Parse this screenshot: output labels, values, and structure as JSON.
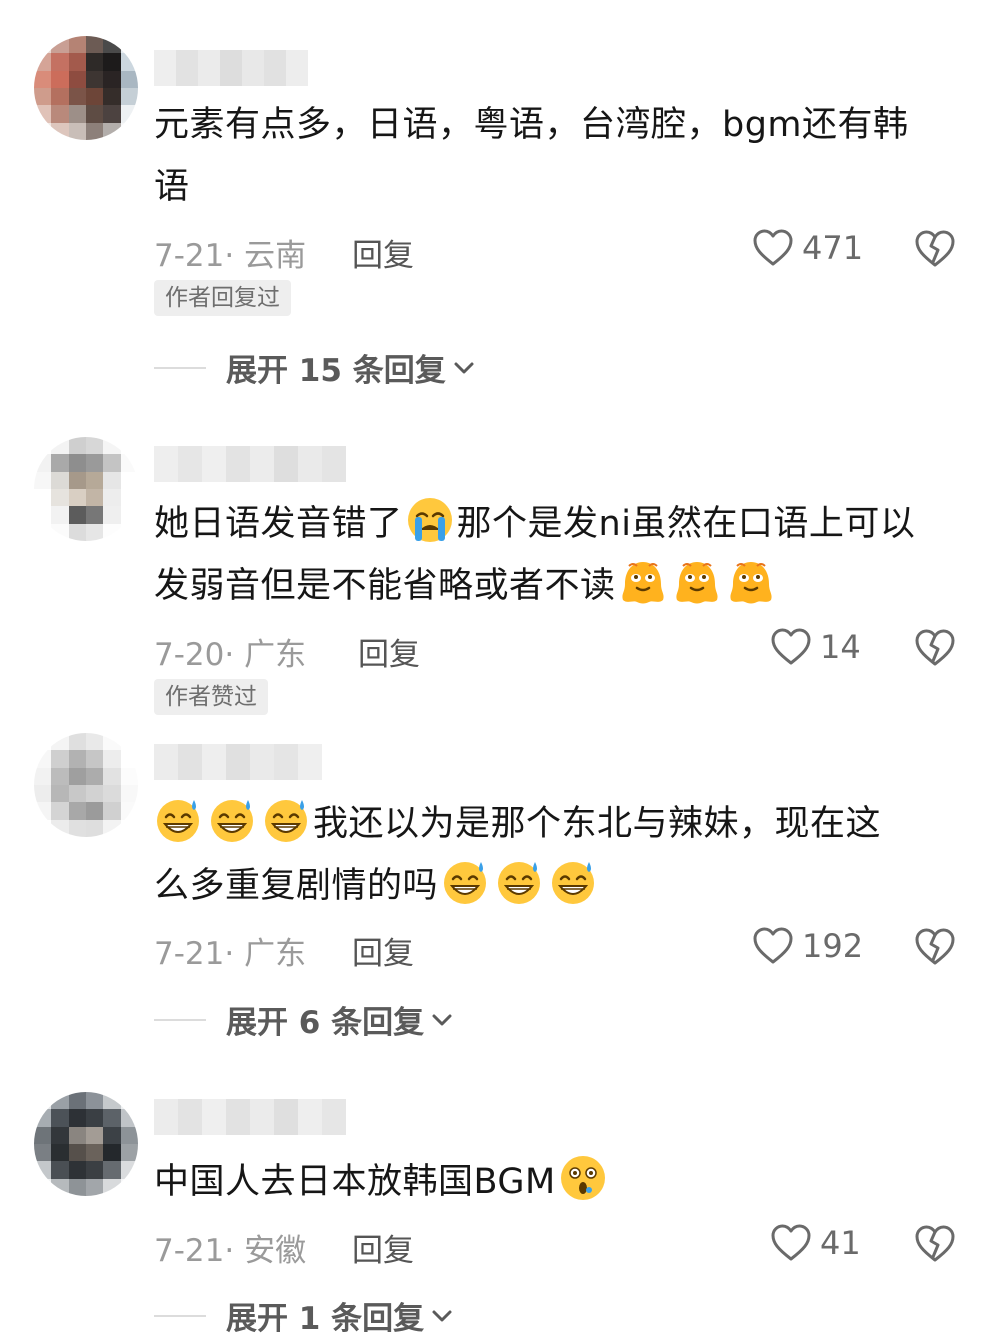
{
  "comments": [
    {
      "text_lines": [
        "元素有点多，日语，粤语，台湾腔，bgm还有韩",
        "语"
      ],
      "date_location": "7-21· 云南",
      "reply_label": "回复",
      "likes": "471",
      "badge": "作者回复过",
      "expand_label": "展开 15 条回复"
    },
    {
      "text_line1": "她日语发音错了",
      "text_line1_b": "那个是发ni虽然在口语上可以",
      "text_line2": "发弱音但是不能省略或者不读",
      "date_location": "7-20· 广东",
      "reply_label": "回复",
      "likes": "14",
      "badge": "作者赞过"
    },
    {
      "text_line1": "我还以为是那个东北与辣妹，现在这",
      "text_line2": "么多重复剧情的吗",
      "date_location": "7-21· 广东",
      "reply_label": "回复",
      "likes": "192",
      "expand_label": "展开 6 条回复"
    },
    {
      "text": "中国人去日本放韩国BGM",
      "date_location": "7-21· 安徽",
      "reply_label": "回复",
      "likes": "41",
      "expand_label": "展开 1 条回复"
    }
  ],
  "icons": {
    "like": "heart-outline-icon",
    "dislike": "broken-heart-icon",
    "expand": "chevron-down-icon",
    "emoji_cry": "loudly-crying-face-icon",
    "emoji_melt": "hot-sweat-face-icon",
    "emoji_grin_sweat": "grinning-sweat-face-icon",
    "emoji_surprised": "astonished-face-icon"
  },
  "colors": {
    "text": "#161616",
    "meta": "#9a9a9a",
    "badge_bg": "#eeeeee",
    "emoji_yellow": "#ffc83d"
  }
}
